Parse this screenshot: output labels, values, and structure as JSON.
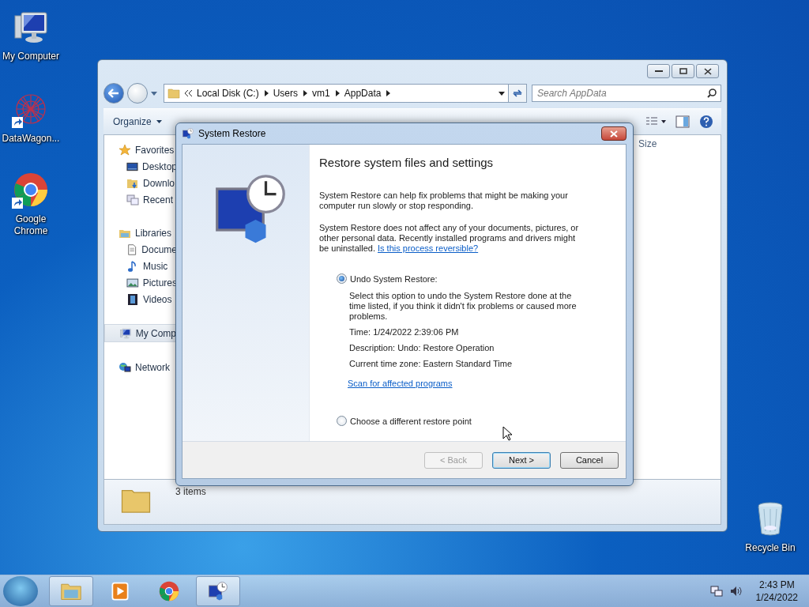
{
  "desktop_icons": [
    {
      "label": "My Computer",
      "kind": "computer",
      "shortcut": false
    },
    {
      "label": "DataWagon...",
      "kind": "network-art",
      "shortcut": true
    },
    {
      "label": "Google Chrome",
      "kind": "chrome",
      "shortcut": true
    },
    {
      "label": "Recycle Bin",
      "kind": "bin",
      "shortcut": false
    }
  ],
  "explorer": {
    "address": [
      "Local Disk (C:)",
      "Users",
      "vm1",
      "AppData"
    ],
    "search": {
      "placeholder": "Search AppData"
    },
    "toolbar": [
      "Organize"
    ],
    "nav": [
      {
        "label": "Favorites",
        "kind": "star",
        "selected": false,
        "children": [
          {
            "label": "Desktop",
            "kind": "desktop",
            "selected": false
          },
          {
            "label": "Downlo",
            "kind": "download",
            "selected": false
          },
          {
            "label": "Recent",
            "kind": "recent",
            "selected": false
          }
        ]
      },
      {
        "label": "Libraries",
        "kind": "library",
        "selected": false,
        "children": [
          {
            "label": "Docume",
            "kind": "document",
            "selected": false
          },
          {
            "label": "Music",
            "kind": "music",
            "selected": false
          },
          {
            "label": "Pictures",
            "kind": "picture",
            "selected": false
          },
          {
            "label": "Videos",
            "kind": "video",
            "selected": false
          }
        ]
      },
      {
        "label": "My Comp",
        "kind": "computer",
        "selected": true
      },
      {
        "label": "Network",
        "kind": "network",
        "selected": false
      }
    ],
    "columns": [
      "Size"
    ],
    "status": "3 items"
  },
  "dialog": {
    "title": "System Restore",
    "heading": "Restore system files and settings",
    "intro": "System Restore can help fix problems that might be making your computer run slowly or stop responding.",
    "note": "System Restore does not affect any of your documents, pictures, or other personal data. Recently installed programs and drivers might be uninstalled.",
    "note_link": "Is this process reversible?",
    "options": [
      {
        "label": "Undo System Restore:",
        "selected": true,
        "details": [
          "Select this option to undo the System Restore done at the time listed, if you think it didn't fix problems or caused more problems.",
          "Time: 1/24/2022 2:39:06 PM",
          "Description: Undo: Restore Operation",
          "Current time zone: Eastern Standard Time"
        ],
        "link": "Scan for affected programs"
      },
      {
        "label": "Choose a different restore point",
        "selected": false
      }
    ],
    "buttons": [
      {
        "label": "< Back",
        "disabled": true,
        "default": false
      },
      {
        "label": "Next >",
        "disabled": false,
        "default": true
      },
      {
        "label": "Cancel",
        "disabled": false,
        "default": false
      }
    ]
  },
  "taskbar": {
    "items": [
      {
        "kind": "explorer",
        "active": true
      },
      {
        "kind": "media",
        "active": false
      },
      {
        "kind": "chrome",
        "active": false
      },
      {
        "kind": "restore",
        "active": true
      }
    ],
    "time": "2:43 PM",
    "date": "1/24/2022"
  }
}
